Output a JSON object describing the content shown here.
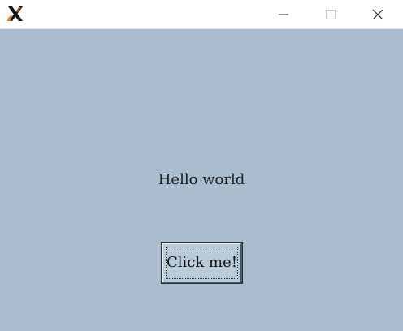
{
  "titlebar": {
    "app_icon": "x-window-system-icon",
    "controls": {
      "minimize_icon": "minimize-icon",
      "maximize_icon": "maximize-icon",
      "close_icon": "close-icon"
    }
  },
  "content": {
    "message": "Hello world",
    "button_label": "Click me!"
  },
  "colors": {
    "client_background": "#aabdcf",
    "button_face": "#b9cad9",
    "titlebar_background": "#ffffff"
  }
}
